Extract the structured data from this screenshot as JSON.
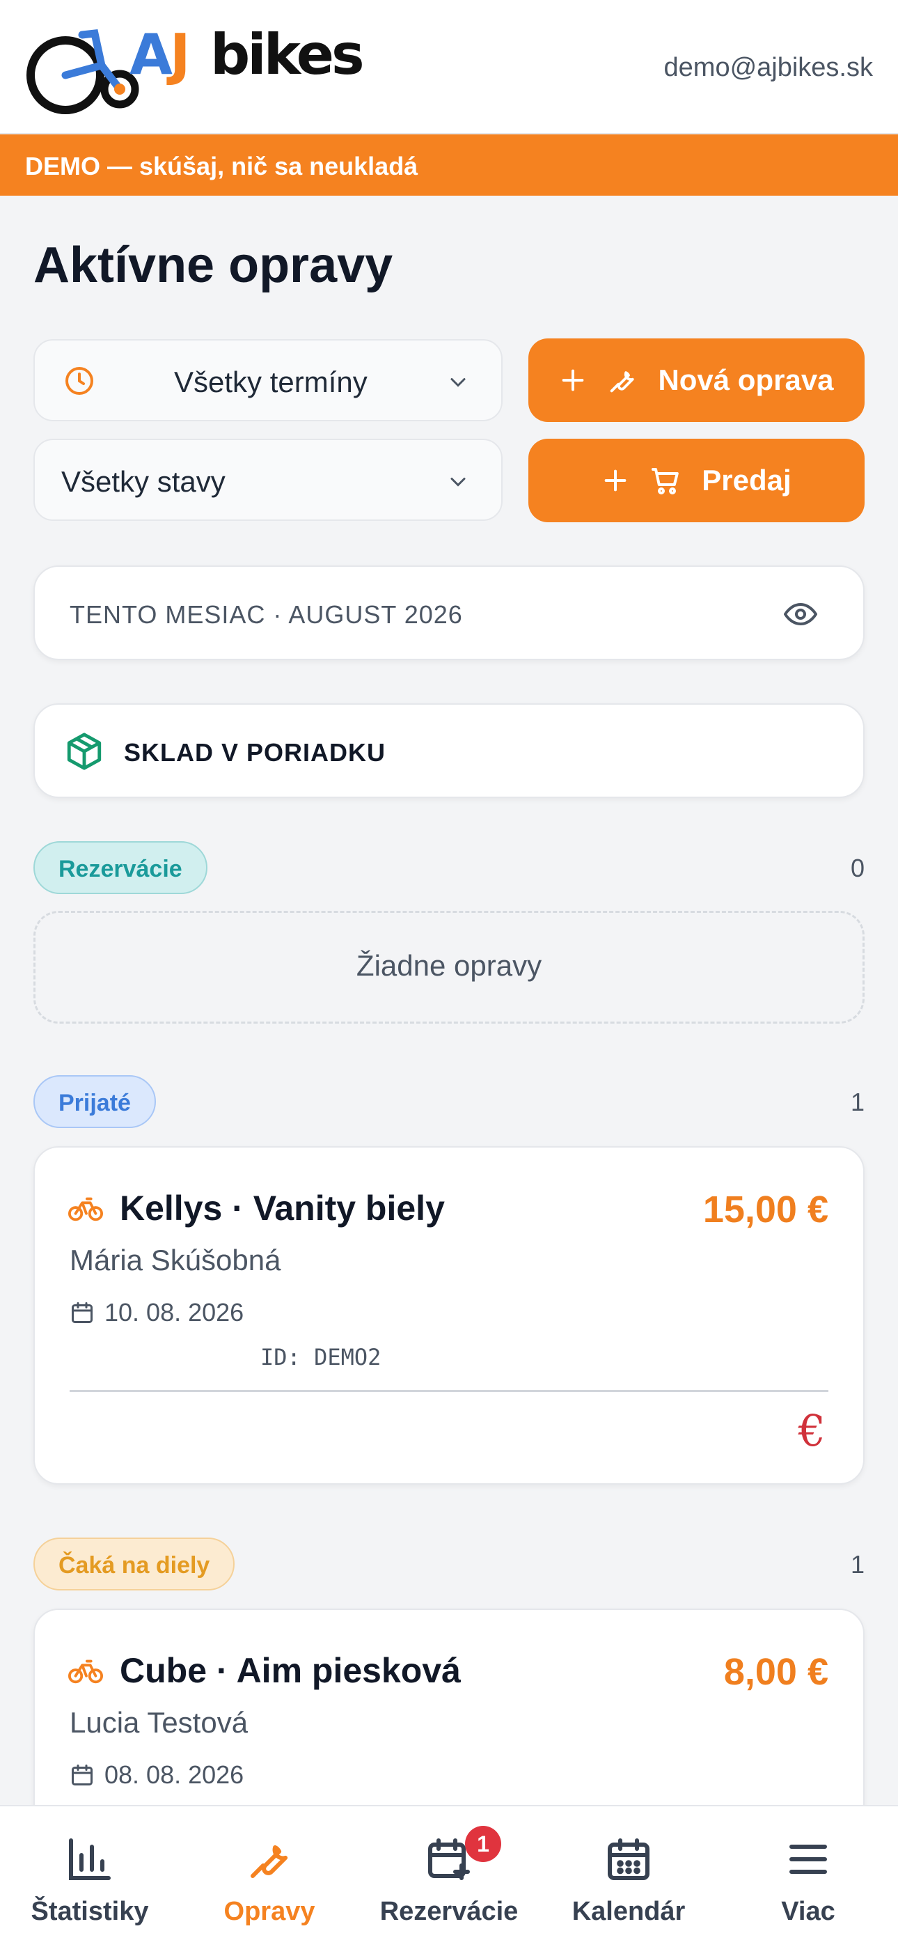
{
  "header": {
    "brand_aj_a": "A",
    "brand_aj_j": "J",
    "brand_bikes": "bikes",
    "user_email": "demo@ajbikes.sk"
  },
  "demo_banner": "DEMO — skúšaj, nič sa neukladá",
  "page_title": "Aktívne opravy",
  "filters": {
    "term_select": "Všetky termíny",
    "status_select": "Všetky stavy"
  },
  "actions": {
    "new_repair": "Nová oprava",
    "sale": "Predaj"
  },
  "month_card": {
    "label": "TENTO MESIAC · AUGUST 2026"
  },
  "stock_card": {
    "label": "SKLAD V PORIADKU"
  },
  "sections": {
    "reservations": {
      "label": "Rezervácie",
      "count": "0",
      "empty_text": "Žiadne opravy"
    },
    "received": {
      "label": "Prijaté",
      "count": "1"
    },
    "waiting_parts": {
      "label": "Čaká na diely",
      "count": "1"
    }
  },
  "repairs": [
    {
      "title": "Kellys · Vanity biely",
      "price": "15,00 €",
      "customer": "Mária Skúšobná",
      "date": "10. 08. 2026",
      "id": "ID: DEMO2"
    },
    {
      "title": "Cube · Aim piesková",
      "price": "8,00 €",
      "customer": "Lucia Testová",
      "date": "08. 08. 2026"
    }
  ],
  "bottom_nav": [
    {
      "label": "Štatistiky"
    },
    {
      "label": "Opravy"
    },
    {
      "label": "Rezervácie",
      "badge": "1"
    },
    {
      "label": "Kalendár"
    },
    {
      "label": "Viac"
    }
  ],
  "colors": {
    "accent": "#f58220",
    "brand_blue": "#3b7bd9",
    "stock_ok": "#159a6e",
    "price_alert": "#d0313a"
  },
  "icons": {
    "logo": "bike-logo-icon",
    "term": "clock-icon",
    "chevron": "chevron-down-icon",
    "new_repair": "wrench-icon",
    "sale": "cart-icon",
    "month": "eye-icon",
    "stock": "package-icon",
    "repair_type": "bicycle-icon",
    "date": "calendar-icon",
    "payment": "euro-icon"
  }
}
